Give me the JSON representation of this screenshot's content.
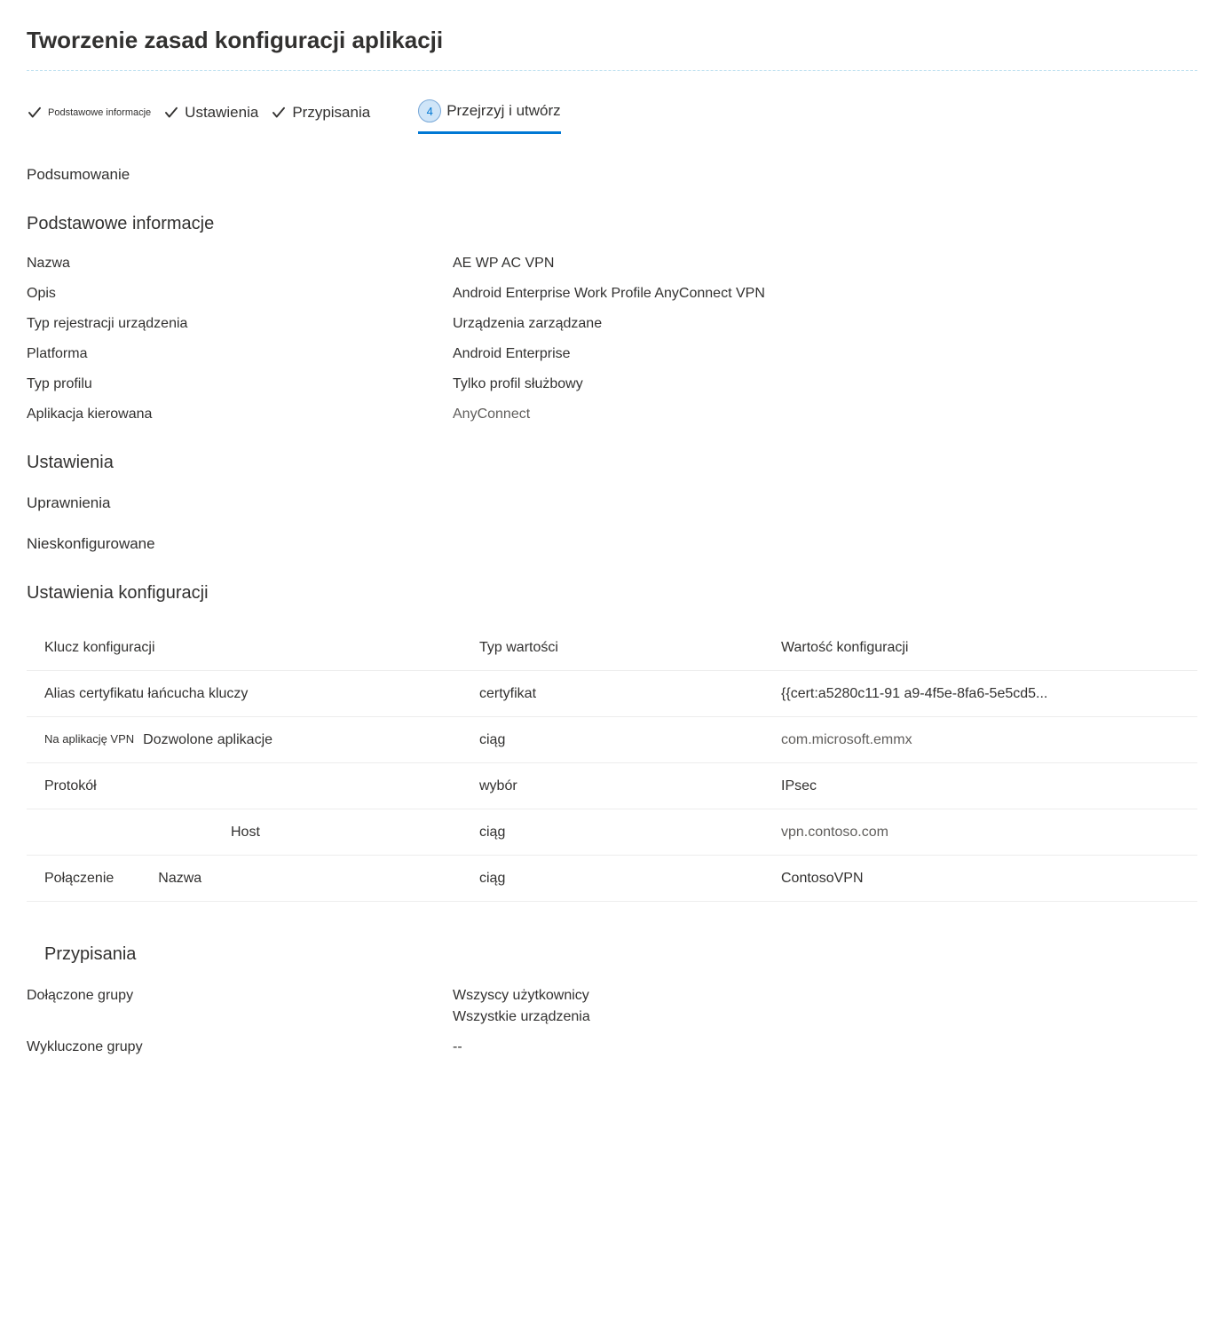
{
  "page": {
    "title": "Tworzenie zasad konfiguracji aplikacji"
  },
  "stepper": {
    "step1": "Podstawowe informacje",
    "step2": "Ustawienia",
    "step3": "Przypisania",
    "step4_num": "4",
    "step4": "Przejrzyj i utwórz"
  },
  "summary": {
    "heading": "Podsumowanie"
  },
  "basics": {
    "heading": "Podstawowe informacje",
    "name_label": "Nazwa",
    "name_value": "AE WP AC VPN",
    "desc_label": "Opis",
    "desc_value": "Android Enterprise Work Profile AnyConnect VPN",
    "enroll_label": "Typ rejestracji urządzenia",
    "enroll_value": "Urządzenia zarządzane",
    "platform_label": "Platforma",
    "platform_value": "Android Enterprise",
    "profile_label": "Typ profilu",
    "profile_value": "Tylko profil służbowy",
    "app_label": "Aplikacja kierowana",
    "app_value": "AnyConnect"
  },
  "settings": {
    "heading": "Ustawienia",
    "perm_heading": "Uprawnienia",
    "perm_value": "Nieskonfigurowane"
  },
  "config": {
    "heading": "Ustawienia konfiguracji",
    "col_key": "Klucz konfiguracji",
    "col_type": "Typ wartości",
    "col_value": "Wartość konfiguracji",
    "rows": [
      {
        "key": "Alias certyfikatu łańcucha kluczy",
        "prefix": "",
        "type": "certyfikat",
        "value": "{{cert:a5280c11-91 a9-4f5e-8fa6-5e5cd5...",
        "muted": false
      },
      {
        "key": "Dozwolone aplikacje",
        "prefix": "Na aplikację VPN",
        "type": "ciąg",
        "value": "com.microsoft.emmx",
        "muted": true
      },
      {
        "key": "Protokół",
        "prefix": "",
        "type": "wybór",
        "value": "IPsec",
        "muted": false
      },
      {
        "key": "Host",
        "prefix": "",
        "type": "ciąg",
        "value": "vpn.contoso.com",
        "muted": true,
        "indent": true
      },
      {
        "key": "Nazwa",
        "prefix": "Połączenie",
        "type": "ciąg",
        "value": "ContosoVPN",
        "muted": false
      }
    ]
  },
  "assignments": {
    "heading": "Przypisania",
    "included_label": "Dołączone grupy",
    "included_value1": "Wszyscy użytkownicy",
    "included_value2": "Wszystkie urządzenia",
    "excluded_label": "Wykluczone grupy",
    "excluded_value": "--"
  }
}
